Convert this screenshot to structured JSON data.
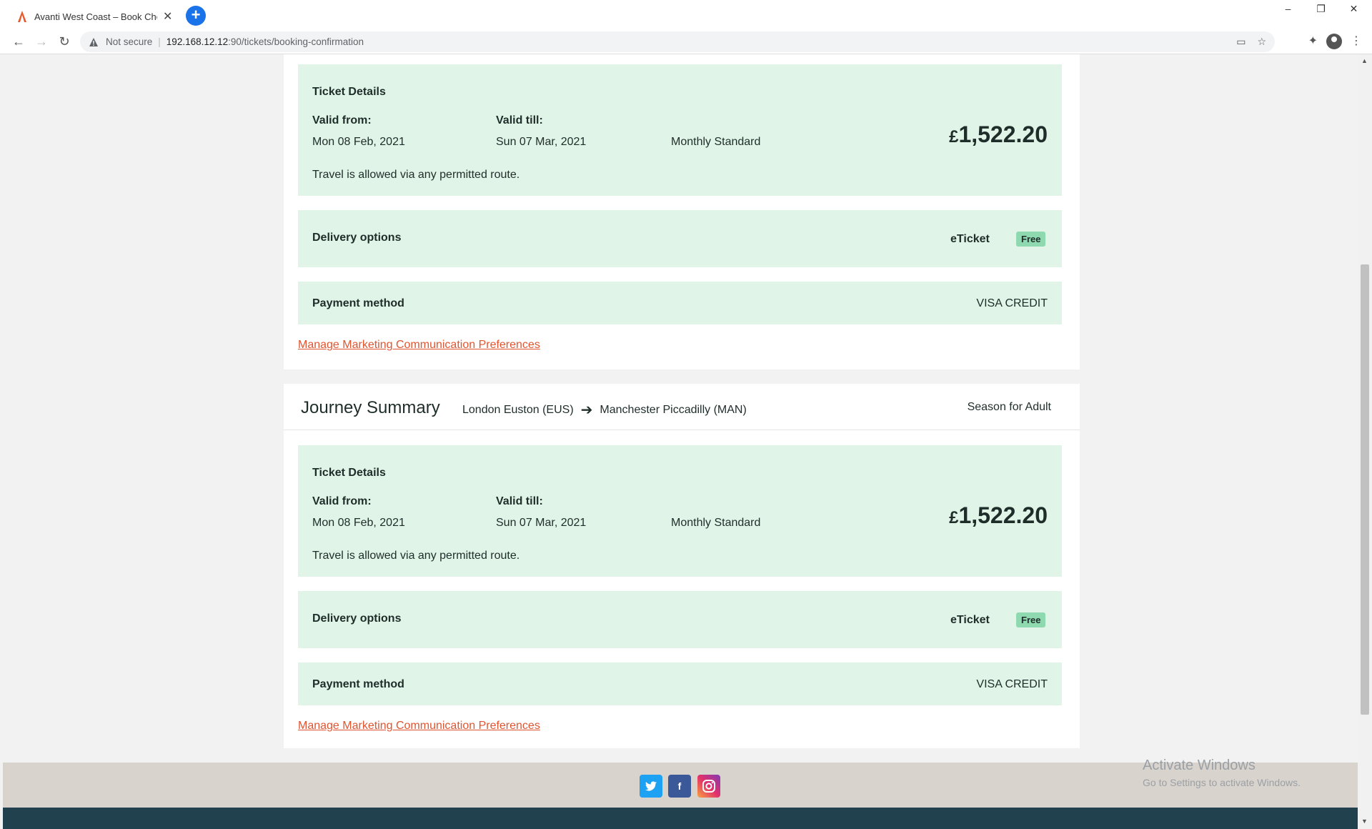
{
  "browser": {
    "tab_title": "Avanti West Coast – Book Cheap",
    "new_tab_glyph": "+",
    "not_secure": "Not secure",
    "url_host": "192.168.12.12",
    "url_path": ":90/tickets/booking-confirmation",
    "window_controls": [
      "–",
      "❐",
      "✕"
    ]
  },
  "bookings": [
    {
      "ticket_details_label": "Ticket Details",
      "valid_from_label": "Valid from:",
      "valid_from": "Mon 08 Feb, 2021",
      "valid_till_label": "Valid till:",
      "valid_till": "Sun 07 Mar, 2021",
      "ticket_type": "Monthly Standard",
      "price_currency": "£",
      "price_amount": "1,522.20",
      "route_note": "Travel is allowed via any permitted route.",
      "delivery_label": "Delivery options",
      "delivery_value": "eTicket",
      "delivery_badge": "Free",
      "payment_label": "Payment method",
      "payment_value": "VISA CREDIT",
      "marketing_link": "Manage Marketing Communication Preferences"
    },
    {
      "ticket_details_label": "Ticket Details",
      "valid_from_label": "Valid from:",
      "valid_from": "Mon 08 Feb, 2021",
      "valid_till_label": "Valid till:",
      "valid_till": "Sun 07 Mar, 2021",
      "ticket_type": "Monthly Standard",
      "price_currency": "£",
      "price_amount": "1,522.20",
      "route_note": "Travel is allowed via any permitted route.",
      "delivery_label": "Delivery options",
      "delivery_value": "eTicket",
      "delivery_badge": "Free",
      "payment_label": "Payment method",
      "payment_value": "VISA CREDIT",
      "marketing_link": "Manage Marketing Communication Preferences"
    }
  ],
  "journey": {
    "title": "Journey Summary",
    "origin": "London Euston (EUS)",
    "destination": "Manchester Piccadilly (MAN)",
    "season_type": "Season for Adult"
  },
  "footer": {
    "social": [
      "twitter-icon",
      "facebook-icon",
      "instagram-icon"
    ],
    "twitter_color": "#1da1f2",
    "facebook_color": "#3b5998"
  },
  "watermark": {
    "line1": "Activate Windows",
    "line2": "Go to Settings to activate Windows."
  }
}
